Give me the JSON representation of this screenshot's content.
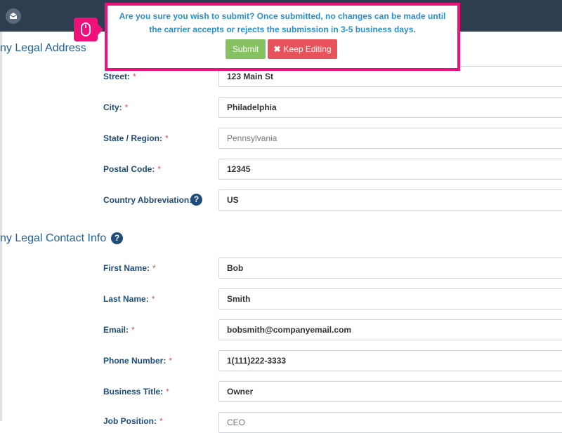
{
  "address_section": {
    "title": "ny Legal Address",
    "fields": [
      {
        "label": "Street:",
        "value": "123 Main St"
      },
      {
        "label": "City:",
        "value": "Philadelphia"
      },
      {
        "label": "State / Region:",
        "value": "Pennsylvania"
      },
      {
        "label": "Postal Code:",
        "value": "12345"
      },
      {
        "label": "Country Abbreviation:",
        "value": "US"
      }
    ]
  },
  "contact_section": {
    "title": "ny Legal Contact Info",
    "fields": [
      {
        "label": "First Name:",
        "value": "Bob"
      },
      {
        "label": "Last Name:",
        "value": "Smith"
      },
      {
        "label": "Email:",
        "value": "bobsmith@companyemail.com"
      },
      {
        "label": "Phone Number:",
        "value": "1(111)222-3333"
      },
      {
        "label": "Business Title:",
        "value": "Owner"
      },
      {
        "label": "Job Position:",
        "value": "CEO"
      }
    ]
  },
  "required_marker": "*",
  "help_glyph": "?",
  "confirm_dialog": {
    "message_line1": "Are you sure you wish to submit? Once submitted, no changes can be made until",
    "message_line2": "the carrier accepts or rejects the submission in 3-5 business days.",
    "submit_label": "Submit",
    "keep_editing_icon": "✖",
    "keep_editing_label": "Keep Editing"
  },
  "icons": {
    "logo": "envelope-badge-icon",
    "cursor": "mouse-icon",
    "help": "question-circle-icon"
  },
  "colors": {
    "topbar": "#2e3d4f",
    "highlight": "#f0107a",
    "label": "#1f4d7a",
    "section_title": "#1f5f9a",
    "submit": "#86c162",
    "keep_editing": "#e8535b",
    "required": "#d9534f"
  }
}
